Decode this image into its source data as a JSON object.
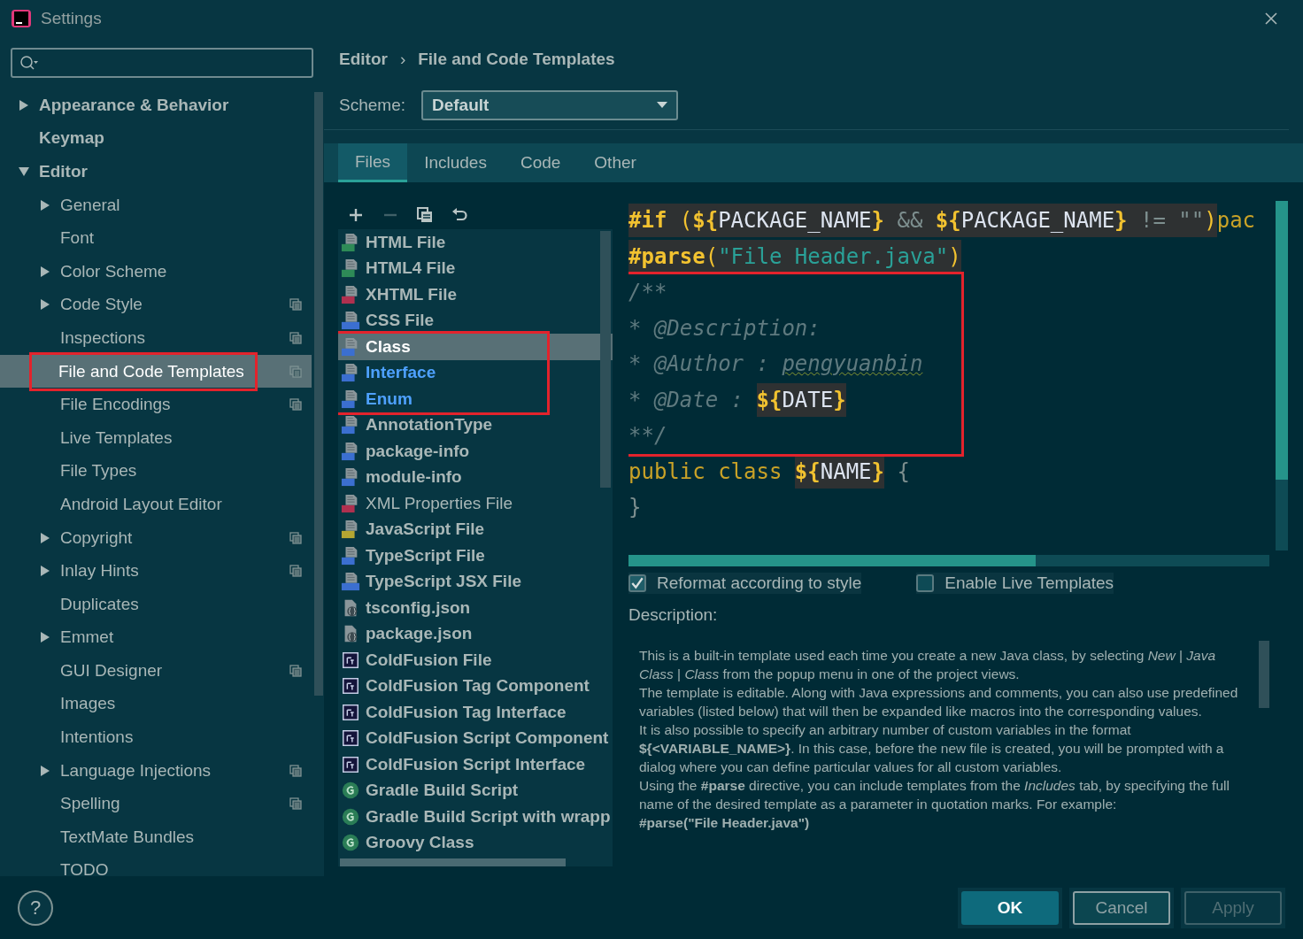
{
  "window": {
    "title": "Settings"
  },
  "sidebar": {
    "items": [
      {
        "label": "Appearance & Behavior",
        "kind": "branch",
        "expanded": false,
        "selected": false,
        "project_scope": false,
        "outlined": false
      },
      {
        "label": "Keymap",
        "kind": "leaf",
        "selected": false,
        "project_scope": false,
        "outlined": false
      },
      {
        "label": "Editor",
        "kind": "branch",
        "expanded": true,
        "selected": false,
        "project_scope": false,
        "outlined": false,
        "children": [
          {
            "label": "General",
            "kind": "branch",
            "expanded": false,
            "selected": false,
            "project_scope": false,
            "outlined": false
          },
          {
            "label": "Font",
            "kind": "leaf",
            "selected": false,
            "project_scope": false,
            "outlined": false
          },
          {
            "label": "Color Scheme",
            "kind": "branch",
            "expanded": false,
            "selected": false,
            "project_scope": false,
            "outlined": false
          },
          {
            "label": "Code Style",
            "kind": "branch",
            "expanded": false,
            "selected": false,
            "project_scope": true,
            "outlined": false
          },
          {
            "label": "Inspections",
            "kind": "leaf",
            "selected": false,
            "project_scope": true,
            "outlined": false
          },
          {
            "label": "File and Code Templates",
            "kind": "leaf",
            "selected": true,
            "project_scope": true,
            "outlined": true
          },
          {
            "label": "File Encodings",
            "kind": "leaf",
            "selected": false,
            "project_scope": true,
            "outlined": false
          },
          {
            "label": "Live Templates",
            "kind": "leaf",
            "selected": false,
            "project_scope": false,
            "outlined": false
          },
          {
            "label": "File Types",
            "kind": "leaf",
            "selected": false,
            "project_scope": false,
            "outlined": false
          },
          {
            "label": "Android Layout Editor",
            "kind": "leaf",
            "selected": false,
            "project_scope": false,
            "outlined": false
          },
          {
            "label": "Copyright",
            "kind": "branch",
            "expanded": false,
            "selected": false,
            "project_scope": true,
            "outlined": false
          },
          {
            "label": "Inlay Hints",
            "kind": "branch",
            "expanded": false,
            "selected": false,
            "project_scope": true,
            "outlined": false
          },
          {
            "label": "Duplicates",
            "kind": "leaf",
            "selected": false,
            "project_scope": false,
            "outlined": false
          },
          {
            "label": "Emmet",
            "kind": "branch",
            "expanded": false,
            "selected": false,
            "project_scope": false,
            "outlined": false
          },
          {
            "label": "GUI Designer",
            "kind": "leaf",
            "selected": false,
            "project_scope": true,
            "outlined": false
          },
          {
            "label": "Images",
            "kind": "leaf",
            "selected": false,
            "project_scope": false,
            "outlined": false
          },
          {
            "label": "Intentions",
            "kind": "leaf",
            "selected": false,
            "project_scope": false,
            "outlined": false
          },
          {
            "label": "Language Injections",
            "kind": "branch",
            "expanded": false,
            "selected": false,
            "project_scope": true,
            "outlined": false
          },
          {
            "label": "Spelling",
            "kind": "leaf",
            "selected": false,
            "project_scope": true,
            "outlined": false
          },
          {
            "label": "TextMate Bundles",
            "kind": "leaf",
            "selected": false,
            "project_scope": false,
            "outlined": false
          },
          {
            "label": "TODO",
            "kind": "leaf",
            "selected": false,
            "project_scope": false,
            "outlined": false
          }
        ]
      }
    ]
  },
  "breadcrumb": {
    "items": [
      "Editor",
      "File and Code Templates"
    ],
    "separator": "›"
  },
  "scheme": {
    "label": "Scheme:",
    "value": "Default"
  },
  "tabs": [
    {
      "label": "Files",
      "selected": true
    },
    {
      "label": "Includes",
      "selected": false
    },
    {
      "label": "Code",
      "selected": false
    },
    {
      "label": "Other",
      "selected": false
    }
  ],
  "toolbar": [
    {
      "kind": "add",
      "disabled": false
    },
    {
      "kind": "remove",
      "disabled": true
    },
    {
      "kind": "copy",
      "disabled": false
    },
    {
      "kind": "reset",
      "disabled": false
    }
  ],
  "template_groups": [
    {
      "outlined": false,
      "items": [
        {
          "name": "HTML File",
          "kind": "html",
          "bold": true,
          "modified": false,
          "selected": false
        },
        {
          "name": "HTML4 File",
          "kind": "html",
          "bold": true,
          "modified": false,
          "selected": false
        },
        {
          "name": "XHTML File",
          "kind": "xhtml",
          "bold": true,
          "modified": false,
          "selected": false
        },
        {
          "name": "CSS File",
          "kind": "css",
          "bold": true,
          "modified": false,
          "selected": false
        }
      ]
    },
    {
      "outlined": true,
      "items": [
        {
          "name": "Class",
          "kind": "java",
          "bold": true,
          "modified": true,
          "selected": true
        },
        {
          "name": "Interface",
          "kind": "java",
          "bold": true,
          "modified": true,
          "selected": false
        },
        {
          "name": "Enum",
          "kind": "java",
          "bold": true,
          "modified": true,
          "selected": false
        }
      ]
    },
    {
      "outlined": false,
      "items": [
        {
          "name": "AnnotationType",
          "kind": "java",
          "bold": true,
          "modified": false,
          "selected": false
        },
        {
          "name": "package-info",
          "kind": "java",
          "bold": true,
          "modified": false,
          "selected": false
        },
        {
          "name": "module-info",
          "kind": "java",
          "bold": true,
          "modified": false,
          "selected": false
        },
        {
          "name": "XML Properties File",
          "kind": "xml",
          "bold": false,
          "modified": false,
          "selected": false
        },
        {
          "name": "JavaScript File",
          "kind": "js",
          "bold": true,
          "modified": false,
          "selected": false
        },
        {
          "name": "TypeScript File",
          "kind": "ts",
          "bold": true,
          "modified": false,
          "selected": false
        },
        {
          "name": "TypeScript JSX File",
          "kind": "tsx",
          "bold": true,
          "modified": false,
          "selected": false
        },
        {
          "name": "tsconfig.json",
          "kind": "json",
          "bold": true,
          "modified": false,
          "selected": false
        },
        {
          "name": "package.json",
          "kind": "json",
          "bold": true,
          "modified": false,
          "selected": false
        },
        {
          "name": "ColdFusion File",
          "kind": "cf",
          "bold": true,
          "modified": false,
          "selected": false
        },
        {
          "name": "ColdFusion Tag Component",
          "kind": "cf",
          "bold": true,
          "modified": false,
          "selected": false
        },
        {
          "name": "ColdFusion Tag Interface",
          "kind": "cf",
          "bold": true,
          "modified": false,
          "selected": false
        },
        {
          "name": "ColdFusion Script Component",
          "kind": "cf",
          "bold": true,
          "modified": false,
          "selected": false
        },
        {
          "name": "ColdFusion Script Interface",
          "kind": "cf",
          "bold": true,
          "modified": false,
          "selected": false
        },
        {
          "name": "Gradle Build Script",
          "kind": "gradle",
          "bold": true,
          "modified": false,
          "selected": false
        },
        {
          "name": "Gradle Build Script with wrapp",
          "kind": "gradle",
          "bold": true,
          "modified": false,
          "selected": false
        },
        {
          "name": "Groovy Class",
          "kind": "gradle",
          "bold": true,
          "modified": false,
          "selected": false
        }
      ]
    }
  ],
  "code": {
    "blocks": [
      {
        "outlined": false,
        "lines": [
          {
            "tokens": [
              {
                "text": "#if",
                "kind": "directive",
                "shaded": true
              },
              {
                "text": " (",
                "kind": "paren",
                "shaded": true
              },
              {
                "text": "${",
                "kind": "delim",
                "shaded": true
              },
              {
                "text": "PACKAGE_NAME",
                "kind": "var",
                "shaded": true
              },
              {
                "text": "}",
                "kind": "delim",
                "shaded": true
              },
              {
                "text": " && ",
                "kind": "op",
                "shaded": true
              },
              {
                "text": "${",
                "kind": "delim",
                "shaded": true
              },
              {
                "text": "PACKAGE_NAME",
                "kind": "var",
                "shaded": true
              },
              {
                "text": "}",
                "kind": "delim",
                "shaded": true
              },
              {
                "text": " != \"\"",
                "kind": "op",
                "shaded": true
              },
              {
                "text": ")",
                "kind": "paren",
                "shaded": true
              },
              {
                "text": "pac",
                "kind": "keyword",
                "shaded": false
              }
            ]
          },
          {
            "tokens": [
              {
                "text": "#parse",
                "kind": "directive",
                "shaded": true
              },
              {
                "text": "(",
                "kind": "paren",
                "shaded": true
              },
              {
                "text": "\"File Header.java\"",
                "kind": "string",
                "shaded": true
              },
              {
                "text": ")",
                "kind": "paren",
                "shaded": true
              }
            ]
          }
        ]
      },
      {
        "outlined": true,
        "lines": [
          {
            "tokens": [
              {
                "text": "/**",
                "kind": "comment",
                "shaded": false
              }
            ]
          },
          {
            "tokens": [
              {
                "text": "* @Description:",
                "kind": "comment",
                "shaded": false
              }
            ]
          },
          {
            "tokens": [
              {
                "text": "* @Author : ",
                "kind": "comment",
                "shaded": false
              },
              {
                "text": "pengyuanbin",
                "kind": "misspelled",
                "shaded": false
              }
            ]
          },
          {
            "tokens": [
              {
                "text": "* @Date : ",
                "kind": "comment",
                "shaded": false
              },
              {
                "text": "${",
                "kind": "delim",
                "shaded": true
              },
              {
                "text": "DATE",
                "kind": "var",
                "shaded": true
              },
              {
                "text": "}",
                "kind": "delim",
                "shaded": true
              }
            ]
          },
          {
            "tokens": [
              {
                "text": "**/",
                "kind": "comment",
                "shaded": false
              }
            ]
          }
        ]
      },
      {
        "outlined": false,
        "lines": [
          {
            "tokens": [
              {
                "text": "public class ",
                "kind": "keyword",
                "shaded": false
              },
              {
                "text": "${",
                "kind": "delim",
                "shaded": true
              },
              {
                "text": "NAME",
                "kind": "var",
                "shaded": true
              },
              {
                "text": "}",
                "kind": "delim",
                "shaded": true
              },
              {
                "text": " {",
                "kind": "op",
                "shaded": false
              }
            ]
          },
          {
            "tokens": [
              {
                "text": "}",
                "kind": "op",
                "shaded": false
              }
            ]
          }
        ]
      }
    ]
  },
  "options": [
    {
      "label": "Reformat according to style",
      "checked": true
    },
    {
      "label": "Enable Live Templates",
      "checked": false
    }
  ],
  "description": {
    "label": "Description:",
    "paragraphs": [
      {
        "kind": "text",
        "text": "This is a built-in template used each time you create a new Java class, by selecting *New* | *Java Class* | *Class* from the popup menu in one of the project views."
      },
      {
        "kind": "text",
        "text": "The template is editable. Along with Java expressions and comments, you can also use predefined variables (listed below) that will then be expanded like macros into the corresponding values."
      },
      {
        "kind": "text",
        "text": "It is also possible to specify an arbitrary number of custom variables in the format **${<VARIABLE_NAME>}**. In this case, before the new file is created, you will be prompted with a dialog where you can define particular values for all custom variables."
      },
      {
        "kind": "text",
        "text": "Using the **#parse** directive, you can include templates from the *Includes* tab, by specifying the full name of the desired template as a parameter in quotation marks. For example:"
      },
      {
        "kind": "code",
        "text": "#parse(\"File Header.java\")"
      }
    ]
  },
  "buttons": [
    {
      "label": "OK",
      "kind": "primary",
      "disabled": false
    },
    {
      "label": "Cancel",
      "kind": "normal",
      "disabled": false
    },
    {
      "label": "Apply",
      "kind": "normal",
      "disabled": true
    }
  ],
  "help": {
    "label": "?"
  }
}
